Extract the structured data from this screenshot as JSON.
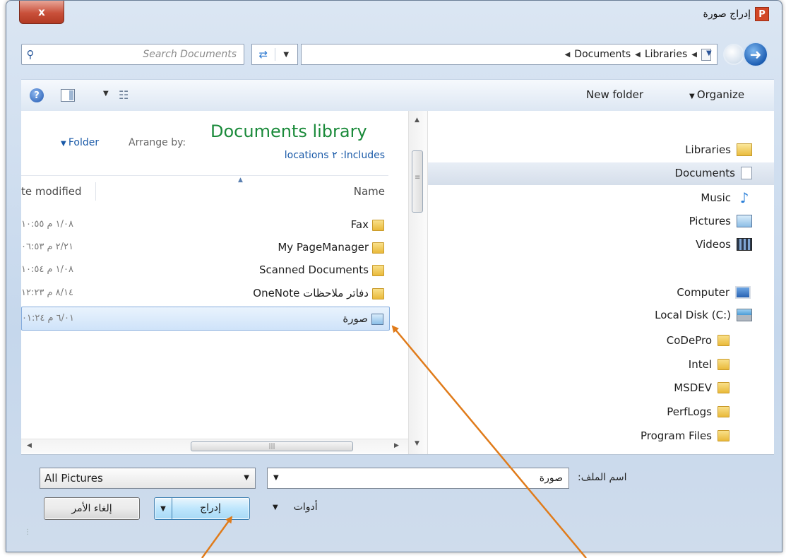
{
  "window": {
    "title": "إدراج صورة",
    "app_icon_letter": "P",
    "close_label": "x"
  },
  "address_bar": {
    "search_placeholder": "Search Documents",
    "breadcrumb": [
      "Libraries",
      "Documents"
    ]
  },
  "toolbar": {
    "help_label": "?",
    "new_folder": "New folder",
    "organize": "Organize"
  },
  "library": {
    "title": "Documents library",
    "includes_label": "Includes:",
    "includes_value": "٢ locations",
    "arrange_label": "Arrange by:",
    "arrange_value": "Folder"
  },
  "columns": {
    "name": "Name",
    "date_modified": "te modified"
  },
  "files": [
    {
      "name": "Fax",
      "type": "folder",
      "date": "١/٠٨ م ١٠:٥٥"
    },
    {
      "name": "My PageManager",
      "type": "folder",
      "date": "٢/٢١ م ٠٦:٥٣"
    },
    {
      "name": "Scanned Documents",
      "type": "folder",
      "date": "١/٠٨ م ١٠:٥٤"
    },
    {
      "name": "OneNote دفاتر ملاحظات",
      "type": "folder",
      "date": "٨/١٤ م ١٢:٢٣"
    },
    {
      "name": "صورة",
      "type": "picture",
      "date": "٦/٠١ م ٠١:٢٤",
      "selected": true
    }
  ],
  "nav_pane": [
    {
      "label": "Libraries",
      "icon": "libraries-icon"
    },
    {
      "label": "Documents",
      "icon": "documents-icon",
      "selected": true
    },
    {
      "label": "Music",
      "icon": "music-icon"
    },
    {
      "label": "Pictures",
      "icon": "pictures-icon"
    },
    {
      "label": "Videos",
      "icon": "videos-icon"
    },
    {
      "label": "Computer",
      "icon": "computer-icon"
    },
    {
      "label": "Local Disk (C:)",
      "icon": "local-disk-icon"
    },
    {
      "label": "CoDePro",
      "icon": "folder-icon"
    },
    {
      "label": "Intel",
      "icon": "folder-icon"
    },
    {
      "label": "MSDEV",
      "icon": "folder-icon"
    },
    {
      "label": "PerfLogs",
      "icon": "folder-icon"
    },
    {
      "label": "Program Files",
      "icon": "folder-icon"
    }
  ],
  "bottom": {
    "filename_label": "اسم الملف:",
    "filename_value": "صورة",
    "filetype_value": "All Pictures",
    "tools_label": "أدوات",
    "insert_label": "إدراج",
    "cancel_label": "إلغاء الأمر"
  },
  "colors": {
    "annotation_arrow": "#e07b1a",
    "library_title": "#1a8a3a",
    "link_blue": "#1a5aa8"
  }
}
